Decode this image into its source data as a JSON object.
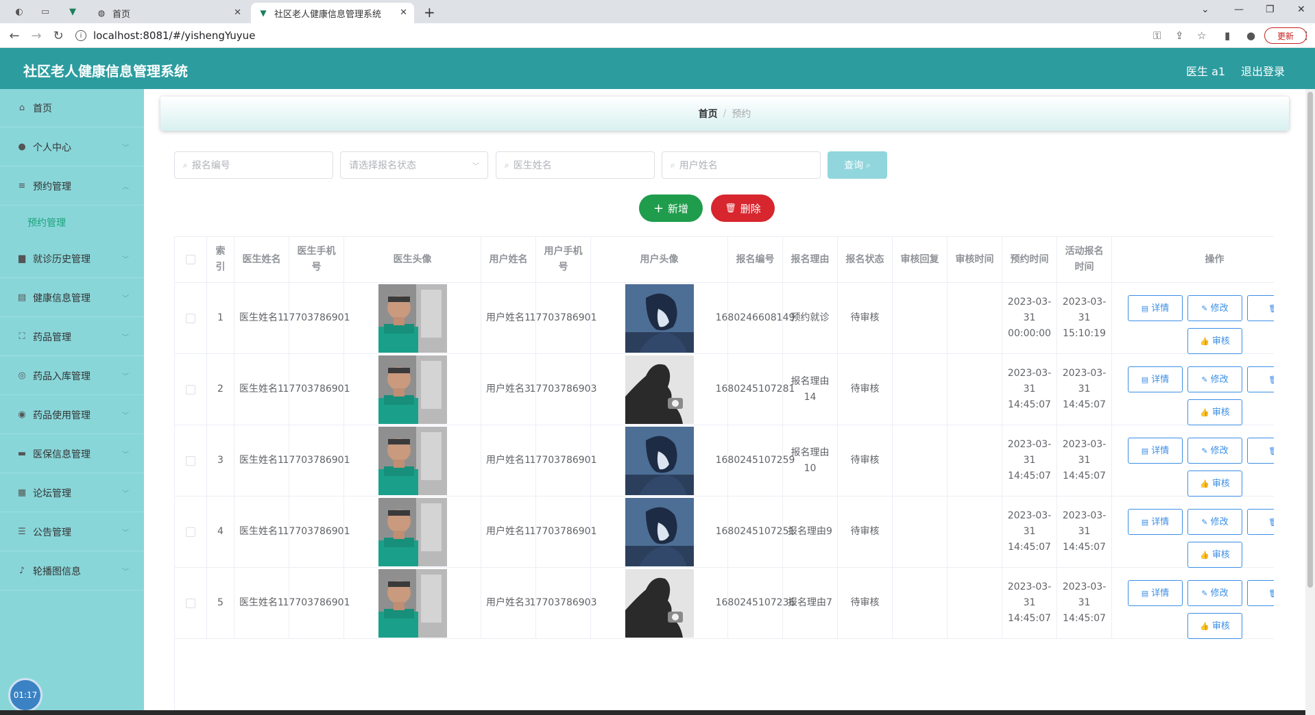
{
  "browser": {
    "tabs": [
      {
        "label": "首页",
        "active": false
      },
      {
        "label": "社区老人健康信息管理系统",
        "active": true
      }
    ],
    "url": "localhost:8081/#/yishengYuyue",
    "update_label": "更新"
  },
  "app": {
    "title": "社区老人健康信息管理系统",
    "user": "医生 a1",
    "logout": "退出登录"
  },
  "sidebar": {
    "items": [
      {
        "label": "首页",
        "icon": "home-icon"
      },
      {
        "label": "个人中心",
        "icon": "user-icon"
      },
      {
        "label": "预约管理",
        "icon": "menu-icon"
      },
      {
        "label": "就诊历史管理",
        "icon": "message-icon"
      },
      {
        "label": "健康信息管理",
        "icon": "document-icon"
      },
      {
        "label": "药品管理",
        "icon": "scan-icon"
      },
      {
        "label": "药品入库管理",
        "icon": "compass-icon"
      },
      {
        "label": "药品使用管理",
        "icon": "target-icon"
      },
      {
        "label": "医保信息管理",
        "icon": "card-icon"
      },
      {
        "label": "论坛管理",
        "icon": "grid-icon"
      },
      {
        "label": "公告管理",
        "icon": "sliders-icon"
      },
      {
        "label": "轮播图信息",
        "icon": "mic-icon"
      }
    ],
    "sub_item": "预约管理",
    "timer": "01:17"
  },
  "breadcrumb": {
    "home": "首页",
    "current": "预约"
  },
  "search": {
    "ticket_placeholder": "报名编号",
    "status_placeholder": "请选择报名状态",
    "doctor_placeholder": "医生姓名",
    "user_placeholder": "用户姓名",
    "query_label": "查询"
  },
  "actions": {
    "add_label": "新增",
    "delete_label": "删除"
  },
  "table": {
    "headers": {
      "index": "索引",
      "doctor_name": "医生姓名",
      "doctor_phone": "医生手机号",
      "doctor_avatar": "医生头像",
      "user_name": "用户姓名",
      "user_phone": "用户手机号",
      "user_avatar": "用户头像",
      "ticket": "报名编号",
      "reason": "报名理由",
      "status": "报名状态",
      "reply": "审核回复",
      "review_time": "审核时间",
      "appt_time": "预约时间",
      "signup_time": "活动报名时间",
      "ops": "操作"
    },
    "op_labels": {
      "detail": "详情",
      "edit": "修改",
      "review": "审核"
    },
    "rows": [
      {
        "index": "1",
        "doctor_name": "医生姓名1",
        "doctor_phone": "17703786901",
        "user_name": "用户姓名1",
        "user_phone": "17703786901",
        "user_avatar": "blue",
        "ticket": "1680246608149",
        "reason": "预约就诊",
        "status": "待审核",
        "reply": "",
        "review_time": "",
        "appt_time": "2023-03-31 00:00:00",
        "signup_time": "2023-03-31 15:10:19"
      },
      {
        "index": "2",
        "doctor_name": "医生姓名1",
        "doctor_phone": "17703786901",
        "user_name": "用户姓名3",
        "user_phone": "17703786903",
        "user_avatar": "gray",
        "ticket": "1680245107281",
        "reason": "报名理由14",
        "status": "待审核",
        "reply": "",
        "review_time": "",
        "appt_time": "2023-03-31 14:45:07",
        "signup_time": "2023-03-31 14:45:07"
      },
      {
        "index": "3",
        "doctor_name": "医生姓名1",
        "doctor_phone": "17703786901",
        "user_name": "用户姓名1",
        "user_phone": "17703786901",
        "user_avatar": "blue",
        "ticket": "1680245107259",
        "reason": "报名理由10",
        "status": "待审核",
        "reply": "",
        "review_time": "",
        "appt_time": "2023-03-31 14:45:07",
        "signup_time": "2023-03-31 14:45:07"
      },
      {
        "index": "4",
        "doctor_name": "医生姓名1",
        "doctor_phone": "17703786901",
        "user_name": "用户姓名1",
        "user_phone": "17703786901",
        "user_avatar": "blue",
        "ticket": "1680245107251",
        "reason": "报名理由9",
        "status": "待审核",
        "reply": "",
        "review_time": "",
        "appt_time": "2023-03-31 14:45:07",
        "signup_time": "2023-03-31 14:45:07"
      },
      {
        "index": "5",
        "doctor_name": "医生姓名1",
        "doctor_phone": "17703786901",
        "user_name": "用户姓名3",
        "user_phone": "17703786903",
        "user_avatar": "gray",
        "ticket": "1680245107236",
        "reason": "报名理由7",
        "status": "待审核",
        "reply": "",
        "review_time": "",
        "appt_time": "2023-03-31 14:45:07",
        "signup_time": "2023-03-31 14:45:07"
      }
    ]
  },
  "colors": {
    "header_bg": "#2c9c9f",
    "sidebar_bg": "#89d6d9",
    "add_green": "#1f9d4c",
    "delete_red": "#d7262e",
    "query_teal": "#91d6dc",
    "op_blue": "#3a8ee6"
  }
}
